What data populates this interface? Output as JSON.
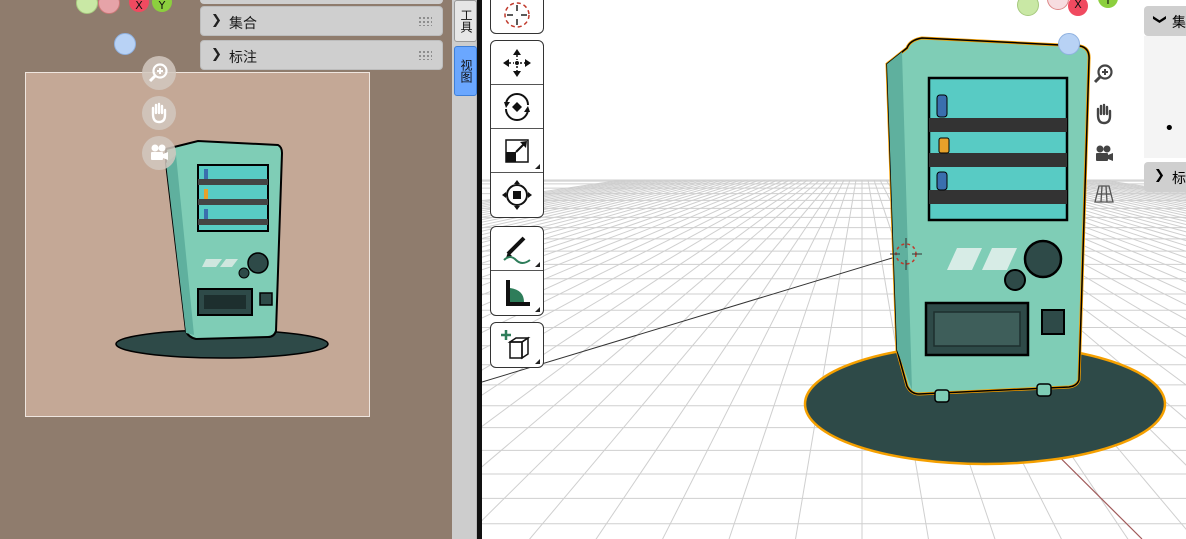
{
  "left_viewport": {
    "panels": [
      {
        "label": "集合"
      },
      {
        "label": "标注"
      }
    ],
    "nav_icons": [
      "zoom-icon",
      "hand-pan-icon",
      "camera-icon"
    ]
  },
  "tabs": [
    {
      "label": "工具",
      "active": false
    },
    {
      "label": "视图",
      "active": true
    }
  ],
  "gizmo": {
    "x_label": "X",
    "y_label": "Y"
  },
  "toolbar": {
    "tools": [
      {
        "name": "cursor-icon"
      },
      {
        "name": "move-icon"
      },
      {
        "name": "rotate-icon"
      },
      {
        "name": "scale-icon"
      },
      {
        "name": "transform-icon"
      },
      {
        "name": "annotate-icon"
      },
      {
        "name": "measure-icon"
      },
      {
        "name": "add-cube-icon"
      }
    ]
  },
  "right_sidebar": {
    "panels": [
      {
        "label": "集",
        "expanded": true
      },
      {
        "label": "标",
        "expanded": false
      }
    ],
    "bullet": "•"
  },
  "colors": {
    "viewport_bg": "#8f7c6d",
    "camera_bg": "#c4a896",
    "machine_body": "#7fcdb6",
    "shadow": "#2e4a48",
    "selection": "#f5a000",
    "active_tab": "#6aa7ff"
  }
}
